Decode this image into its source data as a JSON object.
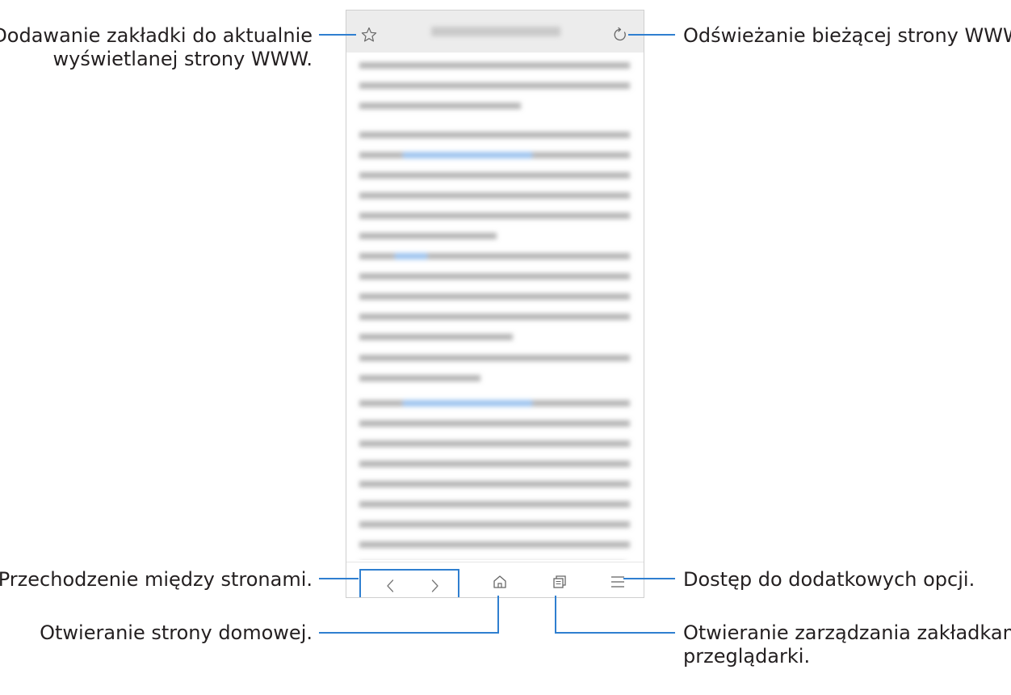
{
  "callouts": {
    "bookmark_line1": "Dodawanie zakładki do aktualnie",
    "bookmark_line2": "wyświetlanej strony WWW.",
    "refresh": "Odświeżanie bieżącej strony WWW.",
    "navigate": "Przechodzenie między stronami.",
    "more_options": "Dostęp do dodatkowych opcji.",
    "home": "Otwieranie strony domowej.",
    "tabs_line1": "Otwieranie zarządzania zakładkami",
    "tabs_line2": "przeglądarki."
  },
  "colors": {
    "callout_line": "#2f7fd0",
    "text": "#231f20",
    "blurred_text": "#b5b5b5",
    "blurred_link": "#9cc3ee"
  },
  "icons": {
    "bookmark": "star-outline-icon",
    "refresh": "refresh-icon",
    "back": "chevron-left-icon",
    "forward": "chevron-right-icon",
    "home": "home-icon",
    "tabs": "tabs-icon",
    "menu": "menu-icon"
  }
}
